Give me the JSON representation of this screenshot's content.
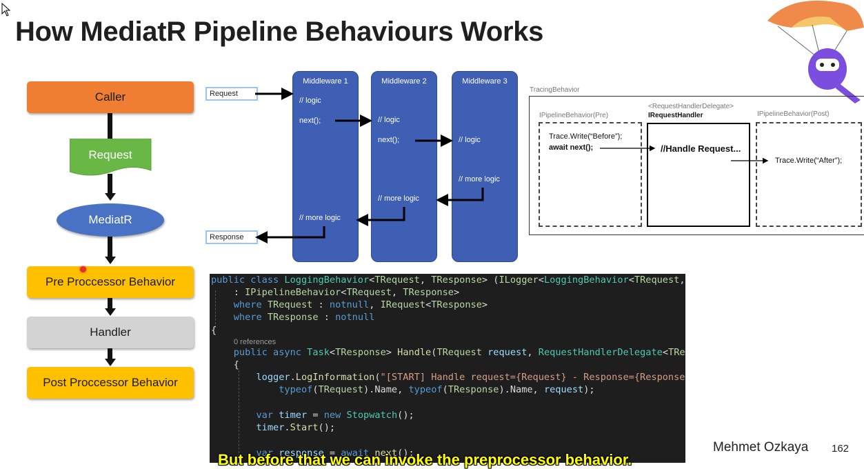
{
  "slide": {
    "title": "How MediatR Pipeline Behaviours Works",
    "author": "Mehmet Ozkaya",
    "page_number": "162",
    "subtitle": "But before that we can invoke the preprocessor behavior."
  },
  "flow": {
    "caller": "Caller",
    "request": "Request",
    "mediatr": "MediatR",
    "pre": "Pre Proccessor Behavior",
    "handler": "Handler",
    "post": "Post Proccessor Behavior",
    "colors": {
      "caller": "#ef7d32",
      "request": "#69b846",
      "mediatr": "#4a72c4",
      "pre": "#ffc000",
      "handler": "#d3d3d3",
      "post": "#ffc000"
    }
  },
  "middleware": {
    "request_label": "Request",
    "response_label": "Response",
    "boxes": [
      {
        "title": "Middleware 1",
        "lines": [
          "// logic",
          "next();",
          "// more logic"
        ]
      },
      {
        "title": "Middleware 2",
        "lines": [
          "// logic",
          "next();",
          "// more logic"
        ]
      },
      {
        "title": "Middleware 3",
        "lines": [
          "// logic",
          "// more logic"
        ]
      }
    ]
  },
  "tracing": {
    "label": "TracingBehavior",
    "pre_label": "IPipelineBehavior(Pre)",
    "delegate_label": "<RequestHandlerDelegate>",
    "handler_label": "IRequestHandler",
    "post_label": "IPipelineBehavior(Post)",
    "pre_line1": "Trace.Write(“Before”);",
    "pre_line2": "await next();",
    "handle": "//Handle Request...",
    "post_line": "Trace.Write(“After”);"
  },
  "code": {
    "references": "0 references"
  }
}
